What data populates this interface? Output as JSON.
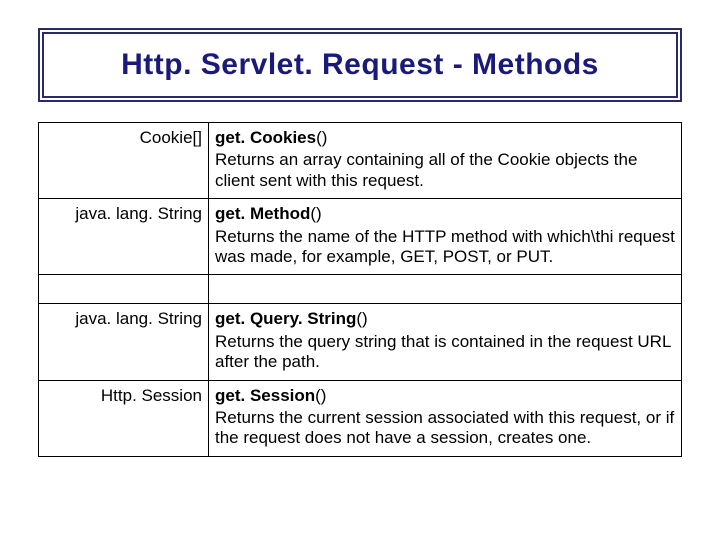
{
  "title": "Http. Servlet. Request - Methods",
  "rows": [
    {
      "return_type": "Cookie[]",
      "method": "get. Cookies",
      "desc": "Returns an array containing all of the Cookie objects the client sent with this request."
    },
    {
      "return_type": "java. lang. String",
      "method": "get. Method",
      "desc": "Returns the name of the HTTP method with which\\thi request was made, for example, GET, POST, or PUT."
    },
    {
      "return_type": "java. lang. String",
      "method": "get. Query. String",
      "desc": "Returns the query string that is contained in the request URL after the path."
    },
    {
      "return_type": "Http. Session",
      "method": "get. Session",
      "desc": "Returns the current session associated with this request, or if the request does not have a session, creates one."
    }
  ]
}
